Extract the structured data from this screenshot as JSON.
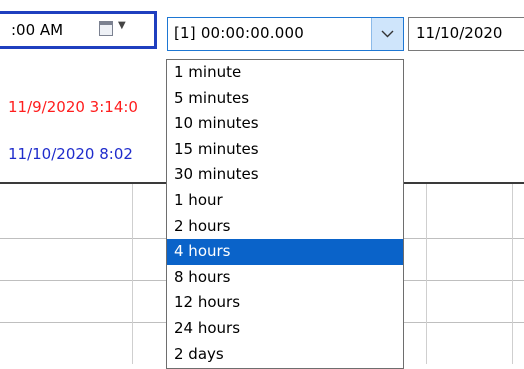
{
  "toolbar": {
    "start_time": ":00 AM",
    "interval_value": "[1] 00:00:00.000",
    "end_date": "11/10/2020"
  },
  "legend": {
    "start": "11/9/2020 3:14:0",
    "end": "11/10/2020 8:02"
  },
  "dropdown": {
    "selected_index": 7,
    "items": [
      "1 minute",
      "5 minutes",
      "10 minutes",
      "15 minutes",
      "30 minutes",
      "1 hour",
      "2 hours",
      "4 hours",
      "8 hours",
      "12 hours",
      "24 hours",
      "2 days"
    ]
  },
  "colors": {
    "start_legend": "#ff1d1d",
    "end_legend": "#1f2ccc",
    "selection": "#0a63c9",
    "focus_border": "#1f3fbf"
  }
}
